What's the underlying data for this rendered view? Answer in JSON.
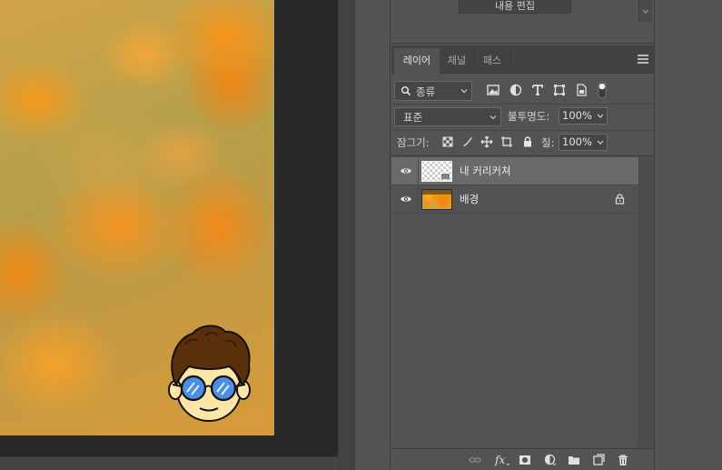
{
  "properties": {
    "content_edit_label": "내용 편집"
  },
  "layers_panel": {
    "tabs": [
      {
        "label": "레이어",
        "active": true
      },
      {
        "label": "채널",
        "active": false
      },
      {
        "label": "패스",
        "active": false
      }
    ],
    "filter_kind": "종류",
    "filter_icons": [
      "image-filter-icon",
      "adjustment-filter-icon",
      "type-filter-icon",
      "shape-filter-icon",
      "smart-object-filter-icon",
      "filter-toggle-icon"
    ],
    "blend_mode": "표준",
    "opacity_label": "불투명도:",
    "opacity_value": "100%",
    "lock_label": "잠그기:",
    "fill_label": "칠:",
    "fill_value": "100%",
    "layers": [
      {
        "name": "내 커리커쳐",
        "visible": true,
        "selected": true,
        "smart_object": true,
        "locked": false
      },
      {
        "name": "배경",
        "visible": true,
        "selected": false,
        "smart_object": false,
        "locked": true
      }
    ],
    "footer_icons": [
      "link-layers-icon",
      "fx-icon",
      "add-mask-icon",
      "new-adjustment-icon",
      "new-group-icon",
      "new-layer-icon",
      "delete-layer-icon"
    ]
  },
  "colors": {
    "panel_bg": "#535353",
    "selected_row": "#6a6a6a",
    "canvas_bg": "#282828"
  }
}
